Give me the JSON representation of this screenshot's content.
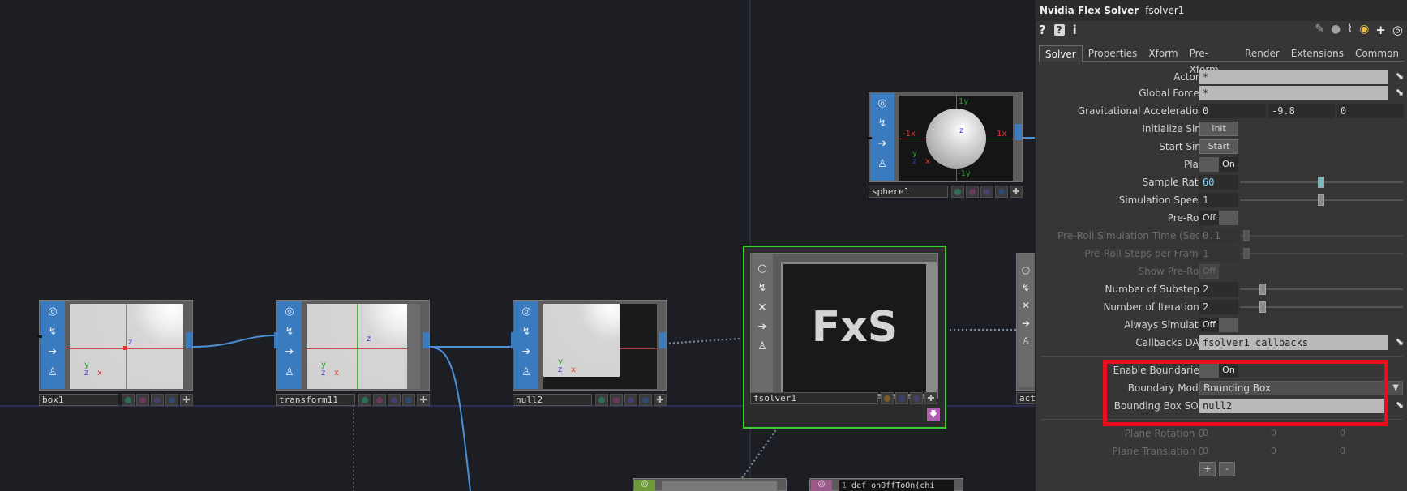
{
  "network": {
    "nodes": [
      {
        "name": "box1"
      },
      {
        "name": "transform11"
      },
      {
        "name": "null2"
      },
      {
        "name": "fsolver1",
        "viewer_text": "FxS"
      },
      {
        "name": "sphere1",
        "axis_labels": {
          "top": "1y",
          "bottom": "-1y",
          "left": "-1x",
          "right": "1x",
          "z": "z"
        }
      },
      {
        "name": "act"
      },
      {
        "name": "def onOffToOn(chi"
      }
    ],
    "viewer_axes": {
      "y": "y",
      "z": "z",
      "x": "x"
    }
  },
  "panel": {
    "op_type": "Nvidia Flex Solver",
    "op_name": "fsolver1",
    "tabs": [
      "Solver",
      "Properties",
      "Xform",
      "Pre-Xform",
      "Render",
      "Extensions",
      "Common"
    ],
    "active_tab": "Solver",
    "params": {
      "actors": {
        "label": "Actors",
        "value": "*"
      },
      "global_forces": {
        "label": "Global Forces",
        "value": "*"
      },
      "grav": {
        "label": "Gravitational Acceleration",
        "x": "0",
        "y": "-9.8",
        "z": "0"
      },
      "init_sim": {
        "label": "Initialize Sim",
        "button": "Init"
      },
      "start_sim": {
        "label": "Start Sim",
        "button": "Start"
      },
      "play": {
        "label": "Play",
        "value": "On"
      },
      "sample_rate": {
        "label": "Sample Rate",
        "value": "60"
      },
      "sim_speed": {
        "label": "Simulation Speed",
        "value": "1"
      },
      "pre_roll": {
        "label": "Pre-Roll",
        "value": "Off"
      },
      "pre_roll_time": {
        "label": "Pre-Roll Simulation Time (Sec)",
        "value": "0.1"
      },
      "pre_roll_steps": {
        "label": "Pre-Roll Steps per Frame",
        "value": "1"
      },
      "show_pre_roll": {
        "label": "Show Pre-Roll",
        "value": "Off"
      },
      "substeps": {
        "label": "Number of Substeps",
        "value": "2"
      },
      "iterations": {
        "label": "Number of Iterations",
        "value": "2"
      },
      "always_sim": {
        "label": "Always Simulate",
        "value": "Off"
      },
      "callbacks": {
        "label": "Callbacks DAT",
        "value": "fsolver1_callbacks"
      },
      "enable_boundaries": {
        "label": "Enable Boundaries",
        "value": "On"
      },
      "boundary_mode": {
        "label": "Boundary Mode",
        "value": "Bounding Box"
      },
      "bbox_sop": {
        "label": "Bounding Box SOP",
        "value": "null2"
      },
      "plane_rotation": {
        "label": "Plane Rotation 0",
        "a": "0",
        "b": "0",
        "c": "0"
      },
      "plane_translation": {
        "label": "Plane Translation 0",
        "a": "0",
        "b": "0",
        "c": "0"
      },
      "add_btn": "+",
      "remove_btn": "-"
    }
  },
  "colors": {
    "highlight": "#e5101b",
    "selected_node": "#38d12c",
    "node_strip": "#3a7bbf",
    "wire": "#4c8fd6"
  }
}
